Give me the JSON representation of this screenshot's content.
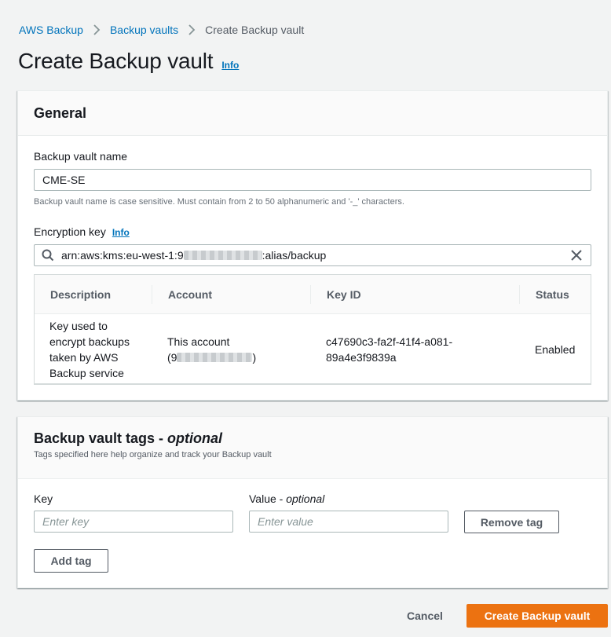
{
  "breadcrumb": {
    "items": [
      "AWS Backup",
      "Backup vaults"
    ],
    "current": "Create Backup vault"
  },
  "page": {
    "title": "Create Backup vault",
    "info": "Info"
  },
  "general": {
    "title": "General",
    "vault_name": {
      "label": "Backup vault name",
      "value": "CME-SE",
      "hint": "Backup vault name is case sensitive. Must contain from 2 to 50 alphanumeric and '-_' characters."
    },
    "encryption": {
      "label": "Encryption key",
      "info": "Info",
      "value_prefix": "arn:aws:kms:eu-west-1:9",
      "value_suffix": ":alias/backup",
      "table": {
        "headers": [
          "Description",
          "Account",
          "Key ID",
          "Status"
        ],
        "row": {
          "description": [
            "Key used to",
            "encrypt backups",
            "taken by AWS",
            "Backup service"
          ],
          "account": "This account",
          "account_id_open": "(9",
          "account_id_close": ")",
          "key_id": [
            "c47690c3-fa2f-41f4-a081-",
            "89a4e3f9839a"
          ],
          "status": "Enabled"
        }
      }
    }
  },
  "tags": {
    "title": "Backup vault tags",
    "title_sep": " - ",
    "optional": "optional",
    "subtitle": "Tags specified here help organize and track your Backup vault",
    "key_label": "Key",
    "value_label": "Value",
    "value_label_sep": " - ",
    "value_optional": "optional",
    "key_placeholder": "Enter key",
    "value_placeholder": "Enter value",
    "remove_tag": "Remove tag",
    "add_tag": "Add tag"
  },
  "footer": {
    "cancel": "Cancel",
    "create": "Create Backup vault"
  },
  "colors": {
    "link": "#0073bb",
    "primary_button": "#ec7211",
    "background": "#f2f3f3"
  }
}
